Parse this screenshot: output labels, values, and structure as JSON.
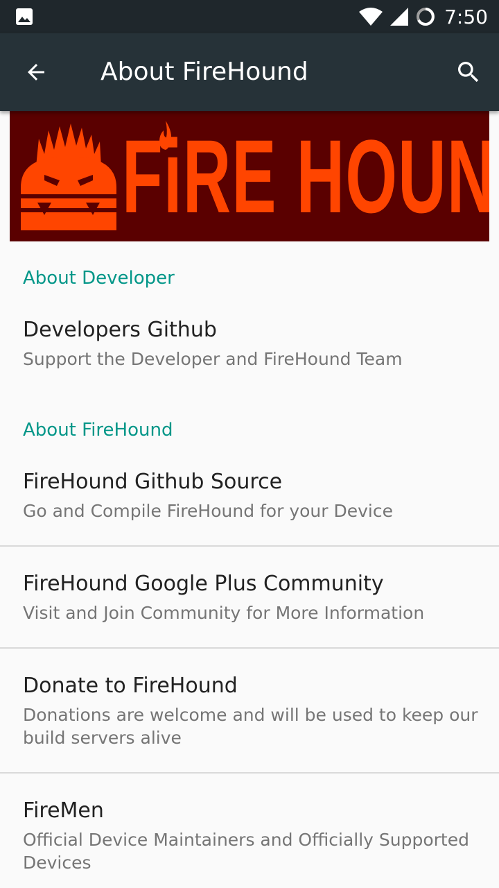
{
  "status_bar": {
    "time": "7:50",
    "icons": [
      "image-icon",
      "wifi-icon",
      "signal-icon",
      "sync-icon"
    ]
  },
  "app_bar": {
    "title": "About FireHound",
    "back_icon": "arrow-back-icon",
    "search_icon": "search-icon"
  },
  "banner": {
    "text": "FiRE HOUND",
    "background": "#5a0000",
    "foreground": "#ff4500"
  },
  "sections": [
    {
      "category": "About Developer",
      "items": [
        {
          "title": "Developers Github",
          "summary": "Support the Developer and FireHound Team"
        }
      ]
    },
    {
      "category": "About FireHound",
      "items": [
        {
          "title": "FireHound Github Source",
          "summary": "Go and Compile FireHound for your Device"
        },
        {
          "title": "FireHound Google Plus Community",
          "summary": "Visit and Join Community for More Information"
        },
        {
          "title": "Donate to FireHound",
          "summary": "Donations are welcome and will be used to keep our build servers alive"
        },
        {
          "title": "FireMen",
          "summary": "Official Device Maintainers and Officially Supported Devices"
        }
      ]
    }
  ],
  "colors": {
    "accent": "#009688",
    "app_bar": "#263238",
    "status_bar": "#1f272c"
  }
}
